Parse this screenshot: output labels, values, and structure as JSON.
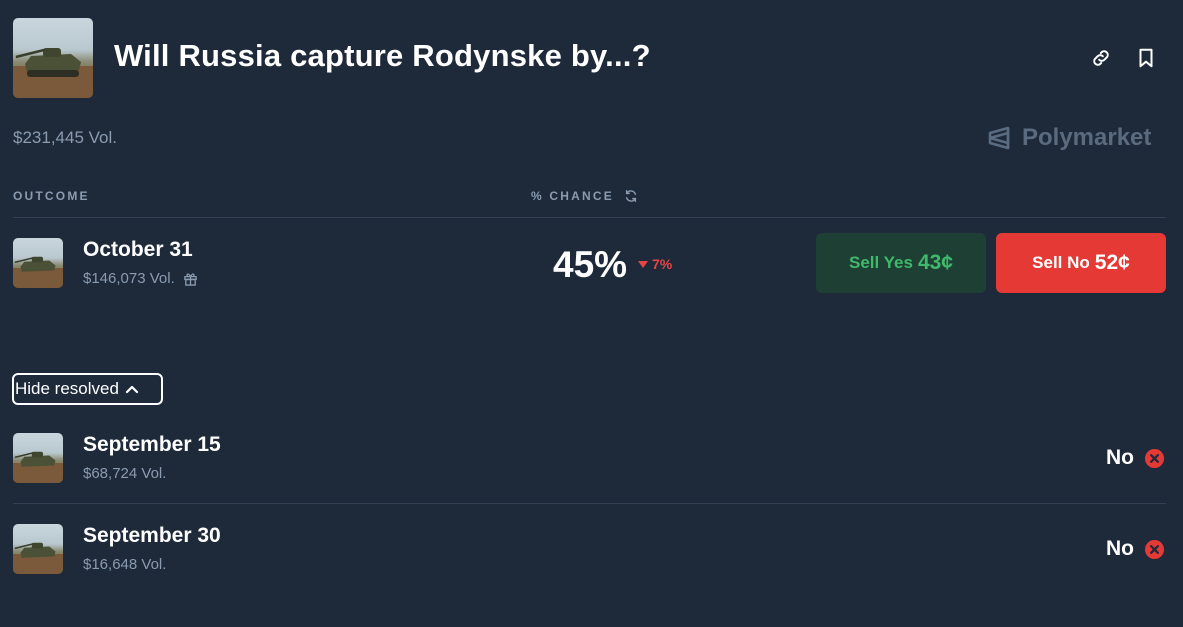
{
  "market": {
    "title": "Will Russia capture Rodynske by...?",
    "volume": "$231,445 Vol.",
    "brand": "Polymarket",
    "thumbnail_icon": "tank-image"
  },
  "header_icons": [
    "link-icon",
    "bookmark-icon"
  ],
  "columns": {
    "outcome": "OUTCOME",
    "chance": "% CHANCE"
  },
  "active_outcome": {
    "label": "October 31",
    "volume": "$146,073 Vol.",
    "chance": "45%",
    "change": "7%",
    "change_direction": "down",
    "sell_yes": {
      "label": "Sell Yes",
      "price": "43¢"
    },
    "sell_no": {
      "label": "Sell No",
      "price": "52¢"
    }
  },
  "toggle": {
    "label": "Hide resolved"
  },
  "resolved": [
    {
      "label": "September 15",
      "volume": "$68,724 Vol.",
      "result": "No"
    },
    {
      "label": "September 30",
      "volume": "$16,648 Vol.",
      "result": "No"
    }
  ],
  "colors": {
    "background": "#1e2a3a",
    "muted_text": "#8b9bb0",
    "yes_green": "#3fb96a",
    "no_red": "#e53935"
  }
}
